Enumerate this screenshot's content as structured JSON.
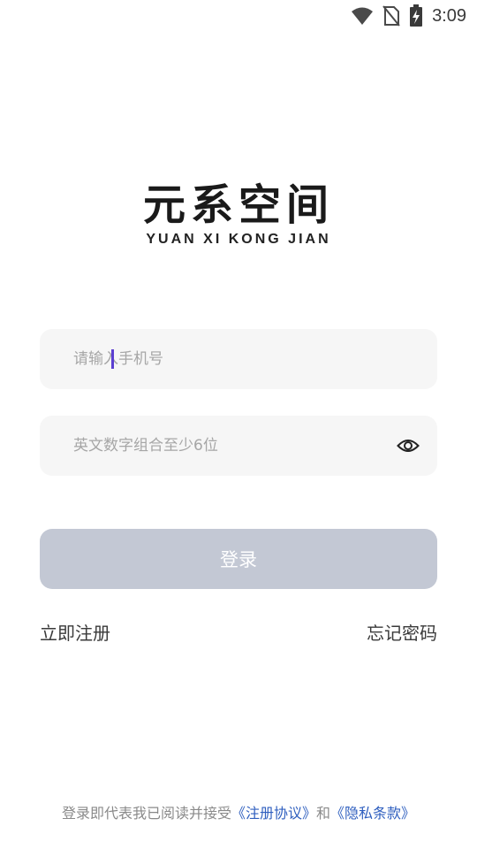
{
  "status_bar": {
    "time": "3:09",
    "icons": [
      "wifi-icon",
      "no-sim-icon",
      "battery-charging-icon"
    ]
  },
  "brand": {
    "title": "元系空间",
    "subtitle": "YUAN XI KONG JIAN"
  },
  "form": {
    "phone": {
      "value": "",
      "placeholder": "请输入手机号"
    },
    "password": {
      "value": "",
      "placeholder": "英文数字组合至少6位",
      "toggle_icon": "eye-icon"
    },
    "login_label": "登录"
  },
  "links": {
    "register": "立即注册",
    "forgot": "忘记密码"
  },
  "agreement": {
    "prefix": "登录即代表我已阅读并接受",
    "terms": "《注册协议》",
    "conjunction": "和",
    "privacy": "《隐私条款》"
  },
  "colors": {
    "button_disabled": "#c3c8d4",
    "field_bg": "#f6f6f6",
    "link": "#2f5fbf",
    "caret": "#5b3fd1"
  }
}
